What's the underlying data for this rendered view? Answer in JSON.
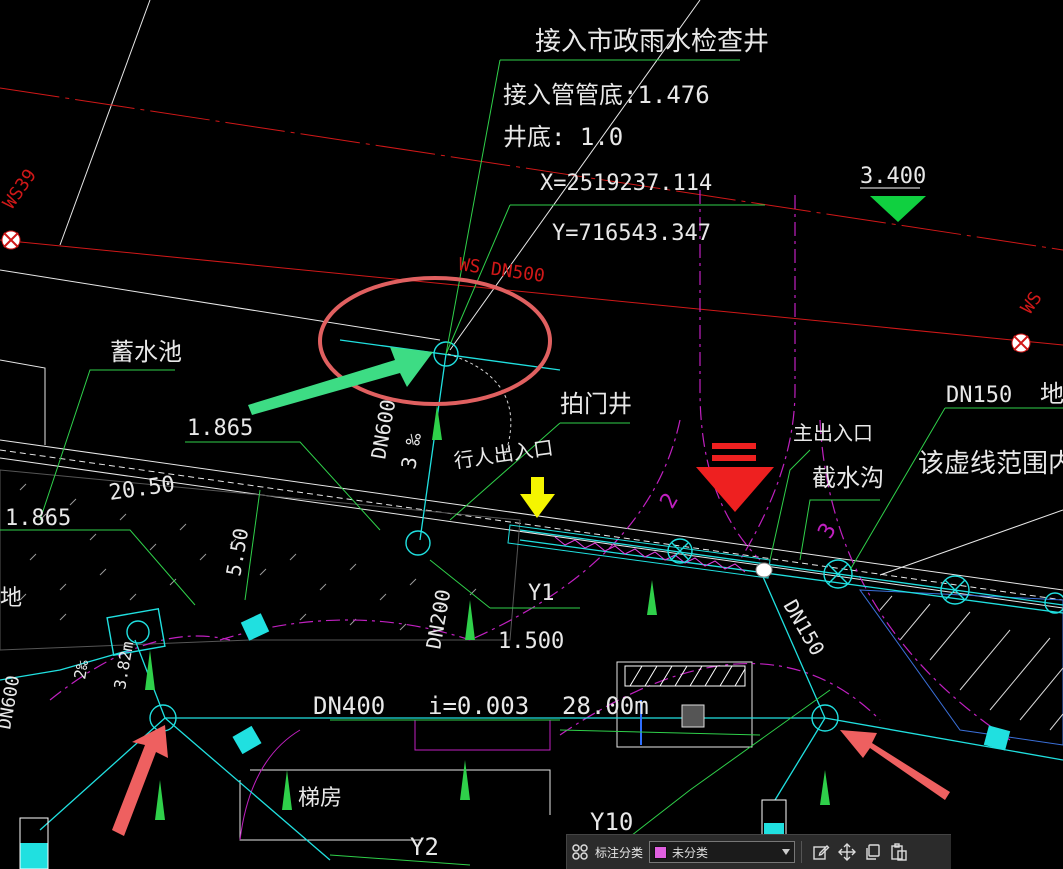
{
  "drawing": {
    "title": "接入市政雨水检查井",
    "pipe_bottom": "接入管管底:1.476",
    "well_bottom": "井底: 1.0",
    "coord_x": "X=2519237.114",
    "coord_y": "Y=716543.347",
    "elevation_marker": "3.400",
    "ws39": "WS39",
    "ws_dn500": "WS DN500",
    "ws_right": "WS",
    "reservoir": "蓄水池",
    "level_1865_a": "1.865",
    "level_1865_b": "1.865",
    "dn600": "DN600",
    "slope_3": "3 ‰",
    "pedestrian_exit": "行人出入口",
    "knock_well": "拍门井",
    "main_exit": "主出入口",
    "intercept_ditch": "截水沟",
    "dn150_top": "DN150",
    "ground_partial": "地",
    "dashed_range": "该虚线范围内",
    "circle_2": "2",
    "circle_3": "3",
    "dim_2050": "20.50",
    "dim_550": "5.50",
    "dn200": "DN200",
    "y1": "Y1",
    "level_1500": "1.500",
    "dn150_mid": "DN150",
    "dn400": "DN400",
    "slope_i": "i=0.003",
    "length_28": "28.00m",
    "stair_room": "梯房",
    "y2": "Y2",
    "y10": "Y10",
    "left_dn": "DN600",
    "left_len": "3.82m",
    "left_frac": "2‰",
    "left_ground": "地"
  },
  "toolbar": {
    "label": "标注分类",
    "selected": "未分类",
    "swatch_color": "#e060e0",
    "icons": [
      "grid-icon",
      "edit-icon",
      "move-icon",
      "copy-icon",
      "paste-icon"
    ]
  },
  "colors": {
    "cyan": "#20e0e0",
    "green": "#2fd04a",
    "magenta": "#c020c0",
    "red": "#d01818",
    "white": "#e8e8e8",
    "highlight_ellipse": "#e06060",
    "arrow_green": "#3ddc84",
    "arrow_red": "#ee6060",
    "arrow_yellow": "#f5f500"
  }
}
